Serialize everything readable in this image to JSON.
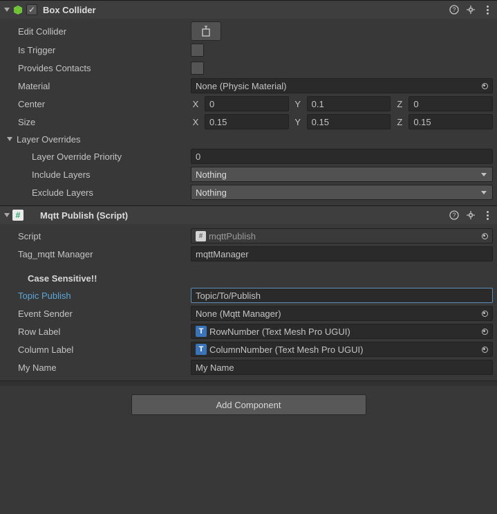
{
  "boxCollider": {
    "title": "Box Collider",
    "enabled": "✓",
    "editCollider": "Edit Collider",
    "isTrigger": "Is Trigger",
    "providesContacts": "Provides Contacts",
    "material": {
      "label": "Material",
      "value": "None (Physic Material)"
    },
    "center": {
      "label": "Center",
      "x": "0",
      "y": "0.1",
      "z": "0"
    },
    "size": {
      "label": "Size",
      "x": "0.15",
      "y": "0.15",
      "z": "0.15"
    },
    "layerOverrides": {
      "title": "Layer Overrides",
      "priority": {
        "label": "Layer Override Priority",
        "value": "0"
      },
      "include": {
        "label": "Include Layers",
        "value": "Nothing"
      },
      "exclude": {
        "label": "Exclude Layers",
        "value": "Nothing"
      }
    }
  },
  "mqtt": {
    "title": "Mqtt Publish (Script)",
    "script": {
      "label": "Script",
      "value": "mqttPublish"
    },
    "tagManager": {
      "label": "Tag_mqtt Manager",
      "value": "mqttManager"
    },
    "caseNote": "Case Sensitive!!",
    "topic": {
      "label": "Topic Publish",
      "value": "Topic/To/Publish"
    },
    "eventSender": {
      "label": "Event Sender",
      "value": "None (Mqtt Manager)"
    },
    "rowLabel": {
      "label": "Row Label",
      "value": "RowNumber (Text Mesh Pro UGUI)"
    },
    "colLabel": {
      "label": "Column Label",
      "value": "ColumnNumber (Text Mesh Pro UGUI)"
    },
    "myName": {
      "label": "My Name",
      "value": "My Name"
    }
  },
  "addComponent": "Add Component",
  "axis": {
    "x": "X",
    "y": "Y",
    "z": "Z"
  }
}
